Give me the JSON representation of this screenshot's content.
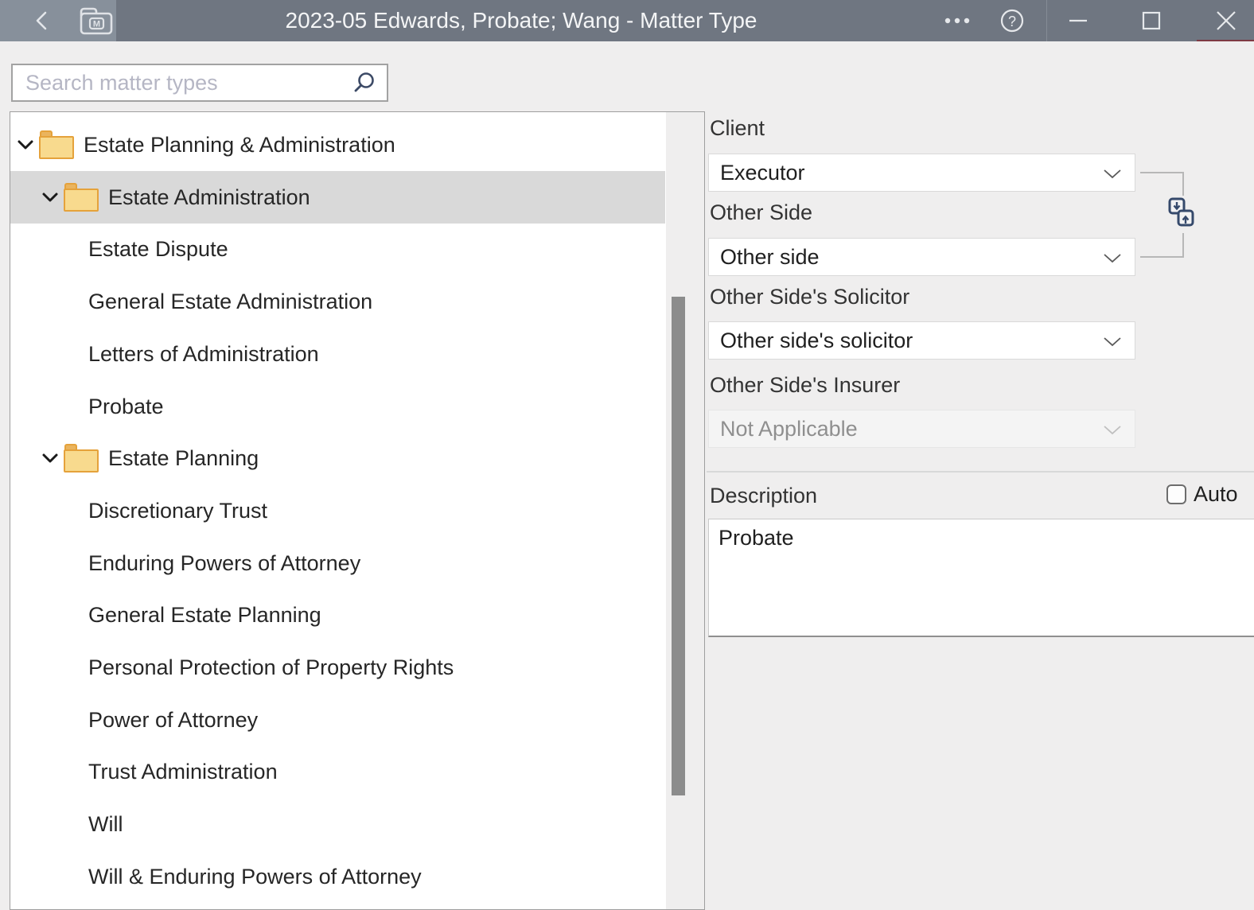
{
  "window": {
    "title": "2023-05 Edwards, Probate; Wang - Matter Type",
    "icons": {
      "back": "back-chevron-icon",
      "app": "folder-m-icon",
      "more": "ellipsis-icon",
      "help": "help-icon",
      "minimize": "minimize-icon",
      "maximize": "maximize-icon",
      "close": "close-icon"
    }
  },
  "search": {
    "placeholder": "Search matter types",
    "value": "",
    "icon": "search-icon"
  },
  "tree": {
    "items": [
      {
        "label": "Estate Planning & Administration",
        "level": 0,
        "type": "folder",
        "expanded": true,
        "selected": false
      },
      {
        "label": "Estate Administration",
        "level": 1,
        "type": "folder",
        "expanded": true,
        "selected": true
      },
      {
        "label": "Estate Dispute",
        "level": 2,
        "type": "leaf",
        "selected": false
      },
      {
        "label": "General Estate Administration",
        "level": 2,
        "type": "leaf",
        "selected": false
      },
      {
        "label": "Letters of Administration",
        "level": 2,
        "type": "leaf",
        "selected": false
      },
      {
        "label": "Probate",
        "level": 2,
        "type": "leaf",
        "selected": false
      },
      {
        "label": "Estate Planning",
        "level": 1,
        "type": "folder",
        "expanded": true,
        "selected": false
      },
      {
        "label": "Discretionary Trust",
        "level": 2,
        "type": "leaf",
        "selected": false
      },
      {
        "label": "Enduring Powers of Attorney",
        "level": 2,
        "type": "leaf",
        "selected": false
      },
      {
        "label": "General Estate Planning",
        "level": 2,
        "type": "leaf",
        "selected": false
      },
      {
        "label": "Personal Protection of Property Rights",
        "level": 2,
        "type": "leaf",
        "selected": false
      },
      {
        "label": "Power of Attorney",
        "level": 2,
        "type": "leaf",
        "selected": false
      },
      {
        "label": "Trust Administration",
        "level": 2,
        "type": "leaf",
        "selected": false
      },
      {
        "label": "Will",
        "level": 2,
        "type": "leaf",
        "selected": false
      },
      {
        "label": "Will & Enduring Powers of Attorney",
        "level": 2,
        "type": "leaf",
        "selected": false
      }
    ]
  },
  "panel": {
    "client": {
      "label": "Client",
      "value": "Executor",
      "disabled": false
    },
    "other_side": {
      "label": "Other Side",
      "value": "Other side",
      "disabled": false
    },
    "other_side_solicitor": {
      "label": "Other Side's Solicitor",
      "value": "Other side's solicitor",
      "disabled": false
    },
    "other_side_insurer": {
      "label": "Other Side's Insurer",
      "value": "Not Applicable",
      "disabled": true
    },
    "swap_icon": "swap-client-other-side-icon",
    "description": {
      "label": "Description",
      "value": "Probate",
      "auto_label": "Auto",
      "auto_checked": false
    }
  },
  "colors": {
    "titlebar": "#6f7681",
    "titlebar_left_segment": "#87909b",
    "window_background": "#efeeee",
    "selection_highlight": "#d9d9d9",
    "folder_fill": "#f8da8e",
    "folder_border": "#e5a23b",
    "accent_navy": "#35496b",
    "disabled_text": "#8f8f8f",
    "scrollbar_thumb": "#8c8c8c",
    "titlebar_red_underline": "#7e3a43"
  }
}
